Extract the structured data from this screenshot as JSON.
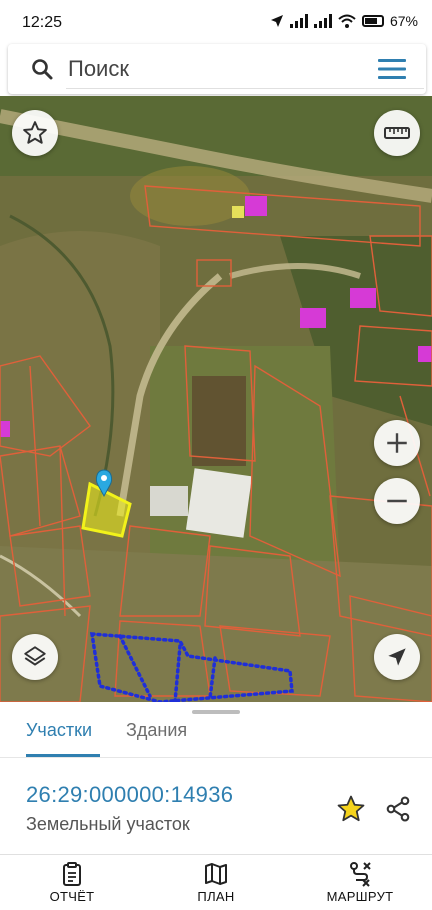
{
  "status_bar": {
    "time": "12:25",
    "battery": "67"
  },
  "search": {
    "placeholder": "Поиск"
  },
  "map": {
    "buttons": [
      "favorites",
      "ruler",
      "zoom-in",
      "zoom-out",
      "layers",
      "my-location"
    ]
  },
  "sheet": {
    "tabs": [
      {
        "label": "Участки",
        "active": true
      },
      {
        "label": "Здания",
        "active": false
      }
    ],
    "parcel": {
      "cadastral_number": "26:29:000000:14936",
      "type": "Земельный участок"
    }
  },
  "bottom_nav": {
    "items": [
      {
        "label": "ОТЧЁТ",
        "icon": "report-icon"
      },
      {
        "label": "ПЛАН",
        "icon": "map-plan-icon"
      },
      {
        "label": "МАРШРУТ",
        "icon": "route-icon"
      }
    ]
  },
  "colors": {
    "accent": "#2f7fb0",
    "parcel_outline": "#e0603a",
    "selected_parcel": "#f2f21a",
    "zone_dots": "#1f2fd8",
    "building_pink": "#d63ad6"
  }
}
